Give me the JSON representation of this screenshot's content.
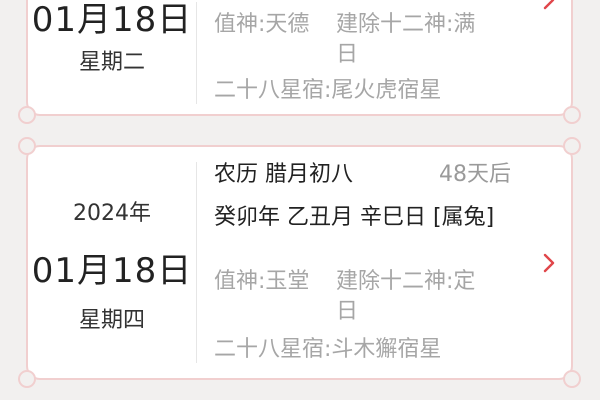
{
  "cards": [
    {
      "day": "01月18日",
      "weekday": "星期二",
      "zhishen": "值神:天德",
      "jianchu": "建除十二神:满日",
      "xingxiu": "二十八星宿:尾火虎宿星"
    },
    {
      "year": "2024年",
      "day": "01月18日",
      "weekday": "星期四",
      "lunar": "农历 腊月初八",
      "days_after": "48天后",
      "ganzhi": "癸卯年 乙丑月 辛巳日 [属兔]",
      "zhishen": "值神:玉堂",
      "jianchu": "建除十二神:定日",
      "xingxiu": "二十八星宿:斗木獬宿星"
    }
  ],
  "colors": {
    "accent": "#e0464a",
    "card_border": "#f1cfcf",
    "background": "#f2f0ef",
    "muted_text": "#a6a6a6"
  },
  "icons": {
    "chevron": "chevron-right-icon"
  }
}
